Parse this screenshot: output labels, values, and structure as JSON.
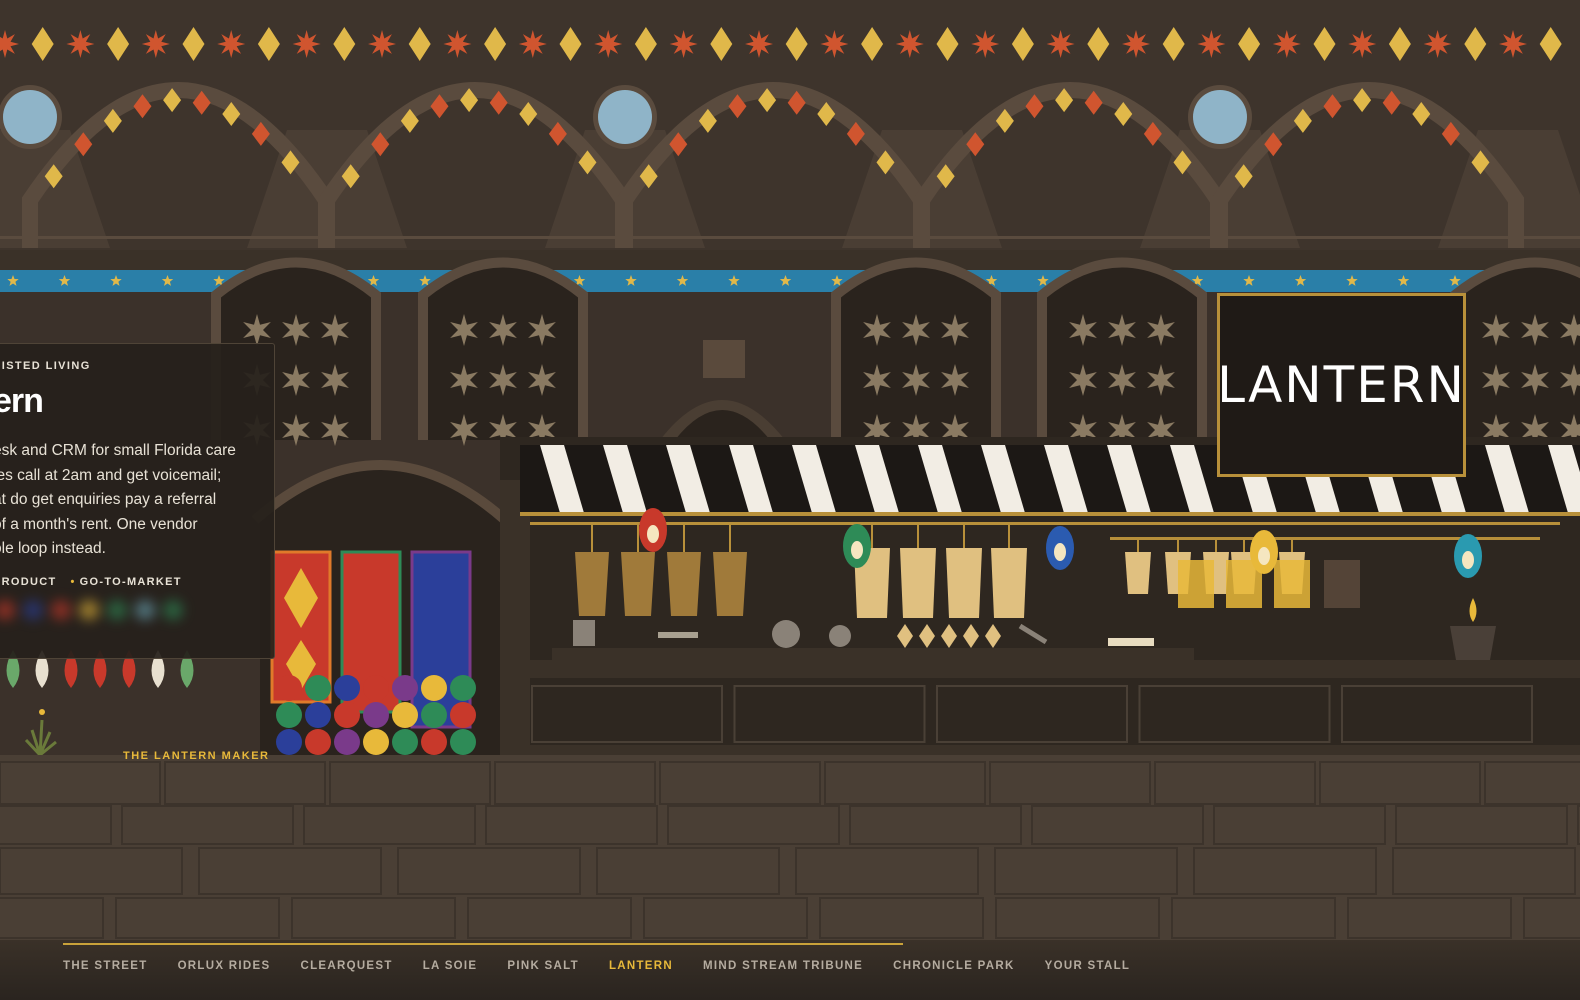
{
  "card": {
    "category": "SISTED LIVING",
    "title": "ern",
    "description_lines": [
      "esk and CRM for small Florida care",
      "ies call at 2am and get voicemail;",
      "at do get enquiries pay a referral",
      "of a month's rent. One vendor",
      "ole loop instead."
    ],
    "tags": [
      "PRODUCT",
      "GO-TO-MARKET"
    ]
  },
  "stall": {
    "sign_text": "LANTERN",
    "maker_label": "THE LANTERN MAKER"
  },
  "nav": {
    "items": [
      "THE STREET",
      "ORLUX RIDES",
      "CLEARQUEST",
      "LA SOIE",
      "PINK SALT",
      "LANTERN",
      "MIND STREAM TRIBUNE",
      "CHRONICLE PARK",
      "YOUR STALL"
    ],
    "active": "LANTERN"
  },
  "colors": {
    "accent": "#e8b93a",
    "background": "#3a3128",
    "sign_border": "#b8903a",
    "star_band": "#2a7fa8"
  }
}
